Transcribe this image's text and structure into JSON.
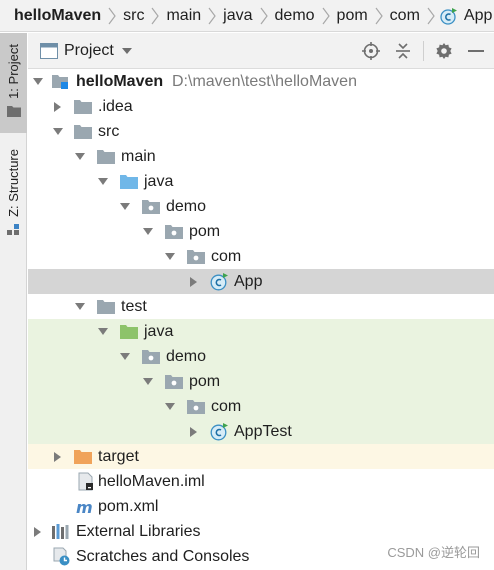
{
  "breadcrumb": [
    "helloMaven",
    "src",
    "main",
    "java",
    "demo",
    "pom",
    "com",
    "App"
  ],
  "tool_strip": {
    "project_tab": "1: Project",
    "structure_tab": "Z: Structure"
  },
  "panel": {
    "title": "Project"
  },
  "tree": {
    "root_label": "helloMaven",
    "root_path": "D:\\maven\\test\\helloMaven",
    "idea": ".idea",
    "src": "src",
    "main": "main",
    "main_java": "java",
    "main_demo": "demo",
    "main_pom": "pom",
    "main_com": "com",
    "app": "App",
    "test": "test",
    "test_java": "java",
    "test_demo": "demo",
    "test_pom": "pom",
    "test_com": "com",
    "apptest": "AppTest",
    "target": "target",
    "iml": "helloMaven.iml",
    "pom_xml": "pom.xml",
    "ext_libs": "External Libraries",
    "scratches": "Scratches and Consoles"
  },
  "watermark": "CSDN @逆轮回",
  "colors": {
    "selection": "#d5d5d5",
    "test_highlight": "#eaf3e0",
    "excluded_highlight": "#fdf7e4",
    "source_folder": "#70b7e8",
    "test_folder": "#8dc36a",
    "target_folder": "#f0a35a",
    "folder": "#9aa7b0"
  }
}
